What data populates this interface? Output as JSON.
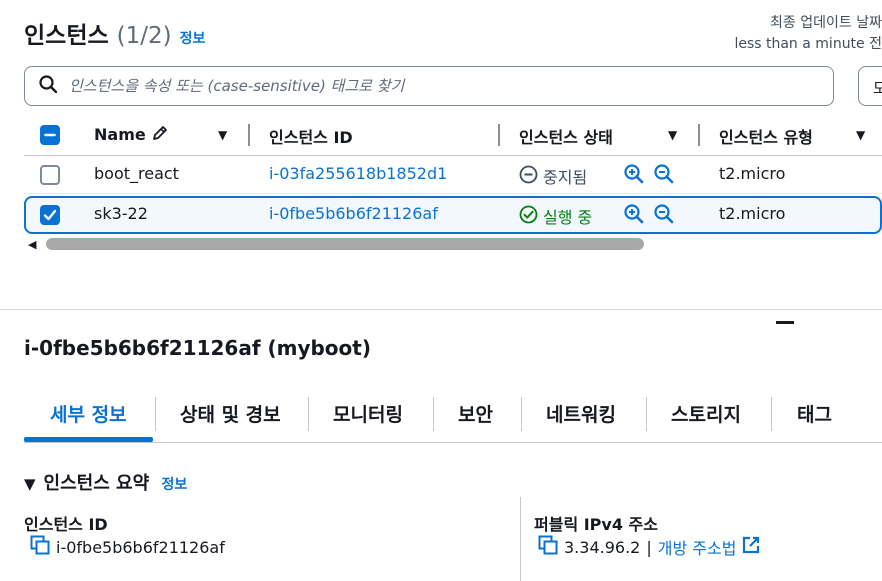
{
  "header": {
    "title": "인스턴스",
    "count": "(1/2)",
    "info": "정보",
    "last_updated_label": "최종 업데이트 날짜",
    "last_updated_value": "less than a minute 전"
  },
  "search": {
    "placeholder": "인스턴스을 속성 또는 (case-sensitive) 태그로 찾기",
    "state_dropdown": "모"
  },
  "table": {
    "columns": [
      "Name",
      "인스턴스 ID",
      "인스턴스 상태",
      "인스턴스 유형"
    ],
    "rows": [
      {
        "name": "boot_react",
        "id": "i-03fa255618b1852d1",
        "state": "중지됨",
        "type": "t2.micro",
        "selected": false
      },
      {
        "name": "sk3-22",
        "id": "i-0fbe5b6b6f21126af",
        "state": "실행 중",
        "type": "t2.micro",
        "selected": true
      }
    ],
    "colors": {
      "running": "#037f0c",
      "stopped": "#5f6b7a",
      "link": "#0972d3"
    }
  },
  "detail": {
    "title": "i-0fbe5b6b6f21126af (myboot)",
    "tabs": [
      "세부 정보",
      "상태 및 경보",
      "모니터링",
      "보안",
      "네트워킹",
      "스토리지",
      "태그"
    ],
    "active_tab": "세부 정보",
    "section_title": "인스턴스 요약",
    "section_info": "정보",
    "instance_id_label": "인스턴스 ID",
    "instance_id_value": "i-0fbe5b6b6f21126af",
    "public_ip_label": "퍼블릭 IPv4 주소",
    "public_ip_value": "3.34.96.2",
    "public_ip_sep": "|",
    "open_address": "개방 주소법"
  }
}
